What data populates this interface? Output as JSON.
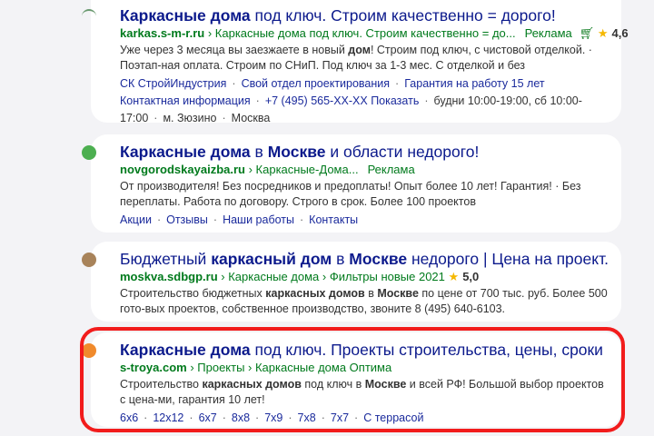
{
  "results": [
    {
      "favicon": "roof-icon",
      "favicon_color": "#6a9a70",
      "title": [
        {
          "t": "Каркасные дома",
          "b": true
        },
        {
          "t": " под ключ. Строим качественно = дорого!"
        }
      ],
      "domain": "karkas.s-m-r.ru",
      "path": "› Каркасные дома под ключ. Строим качественно = до...",
      "ad": "Реклама",
      "rating": "4,6",
      "cart": true,
      "snippet": [
        {
          "t": "Уже через 3 месяца вы заезжаете в новый "
        },
        {
          "t": "дом",
          "b": true
        },
        {
          "t": "! Строим под ключ, с чистовой отделкой. · Поэтап-ная оплата. Строим по СНиП. Под ключ за 1-3 мес. С отделкой и без"
        }
      ],
      "links": [
        "СК СтройИндустрия",
        "Свой отдел проектирования",
        "Гарантия на работу 15 лет"
      ],
      "contacts": {
        "link1": "Контактная информация",
        "phone": "+7 (495) 565-XX-XX Показать",
        "hours": "будни 10:00-19:00, сб 10:00-17:00",
        "metro": "м. Зюзино",
        "city": "Москва"
      }
    },
    {
      "favicon": "house-icon",
      "favicon_color": "#4caf50",
      "title": [
        {
          "t": "Каркасные дома",
          "b": true
        },
        {
          "t": " в "
        },
        {
          "t": "Москве",
          "b": true
        },
        {
          "t": " и области недорого!"
        }
      ],
      "domain": "novgorodskayaizba.ru",
      "path": "› Каркасные-Дома...",
      "ad": "Реклама",
      "snippet": [
        {
          "t": "От производителя! Без посредников и предоплаты! Опыт более 10 лет! Гарантия! · Без переплаты. Работа по договору. Строго в срок. Более 100 проектов"
        }
      ],
      "links": [
        "Акции",
        "Отзывы",
        "Наши работы",
        "Контакты"
      ]
    },
    {
      "favicon": "building-icon",
      "favicon_color": "#a8835a",
      "title": [
        {
          "t": "Бюджетный "
        },
        {
          "t": "каркасный дом",
          "b": true
        },
        {
          "t": " в "
        },
        {
          "t": "Москве",
          "b": true
        },
        {
          "t": " недорого | Цена на проект..."
        }
      ],
      "domain": "moskva.sdbgp.ru",
      "path": "› Каркасные дома › Фильтры новые 2021",
      "rating": "5,0",
      "snippet": [
        {
          "t": "Строительство бюджетных "
        },
        {
          "t": "каркасных домов",
          "b": true
        },
        {
          "t": " в "
        },
        {
          "t": "Москве",
          "b": true
        },
        {
          "t": " по цене от 700 тыс. руб. Более 500 гото-вых проектов, собственное производство, звоните 8 (495) 640-6103."
        }
      ]
    },
    {
      "favicon": "troya-logo-icon",
      "favicon_color": "#f08a2c",
      "title": [
        {
          "t": "Каркасные дома",
          "b": true
        },
        {
          "t": " под ключ. Проекты строительства, цены, сроки"
        }
      ],
      "domain": "s-troya.com",
      "path": "› Проекты › Каркасные дома Оптима",
      "snippet": [
        {
          "t": "Строительство "
        },
        {
          "t": "каркасных домов",
          "b": true
        },
        {
          "t": " под ключ в "
        },
        {
          "t": "Москве",
          "b": true
        },
        {
          "t": " и всей РФ! Большой выбор проектов с цена-ми, гарантия 10 лет!"
        }
      ],
      "links": [
        "6x6",
        "12x12",
        "6x7",
        "8x8",
        "7x9",
        "7x8",
        "7x7",
        "С террасой"
      ]
    }
  ]
}
